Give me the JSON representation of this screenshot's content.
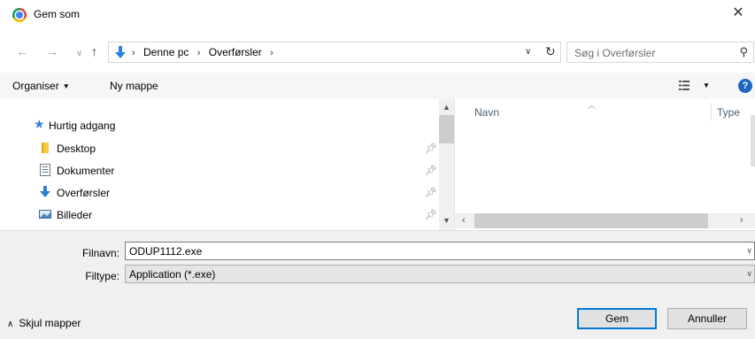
{
  "window": {
    "title": "Gem som"
  },
  "address": {
    "crumbs": [
      "Denne pc",
      "Overførsler"
    ]
  },
  "search": {
    "placeholder": "Søg i Overførsler"
  },
  "toolbar": {
    "organize": "Organiser",
    "new_folder": "Ny mappe"
  },
  "nav": {
    "quick_access": "Hurtig adgang",
    "items": [
      {
        "label": "Desktop",
        "icon": "folder-icon"
      },
      {
        "label": "Dokumenter",
        "icon": "document-icon"
      },
      {
        "label": "Overførsler",
        "icon": "download-arrow-icon"
      },
      {
        "label": "Billeder",
        "icon": "pictures-icon"
      }
    ]
  },
  "files": {
    "col_name": "Navn",
    "col_type": "Type"
  },
  "form": {
    "filename_label": "Filnavn:",
    "filename_value": "ODUP1112.exe",
    "filetype_label": "Filtype:",
    "filetype_value": "Application (*.exe)"
  },
  "footer": {
    "hide_folders": "Skjul mapper",
    "save": "Gem",
    "cancel": "Annuller"
  },
  "colors": {
    "accent": "#0078d7",
    "help": "#1f66c1",
    "quick_access_star": "#3a7fd5"
  }
}
